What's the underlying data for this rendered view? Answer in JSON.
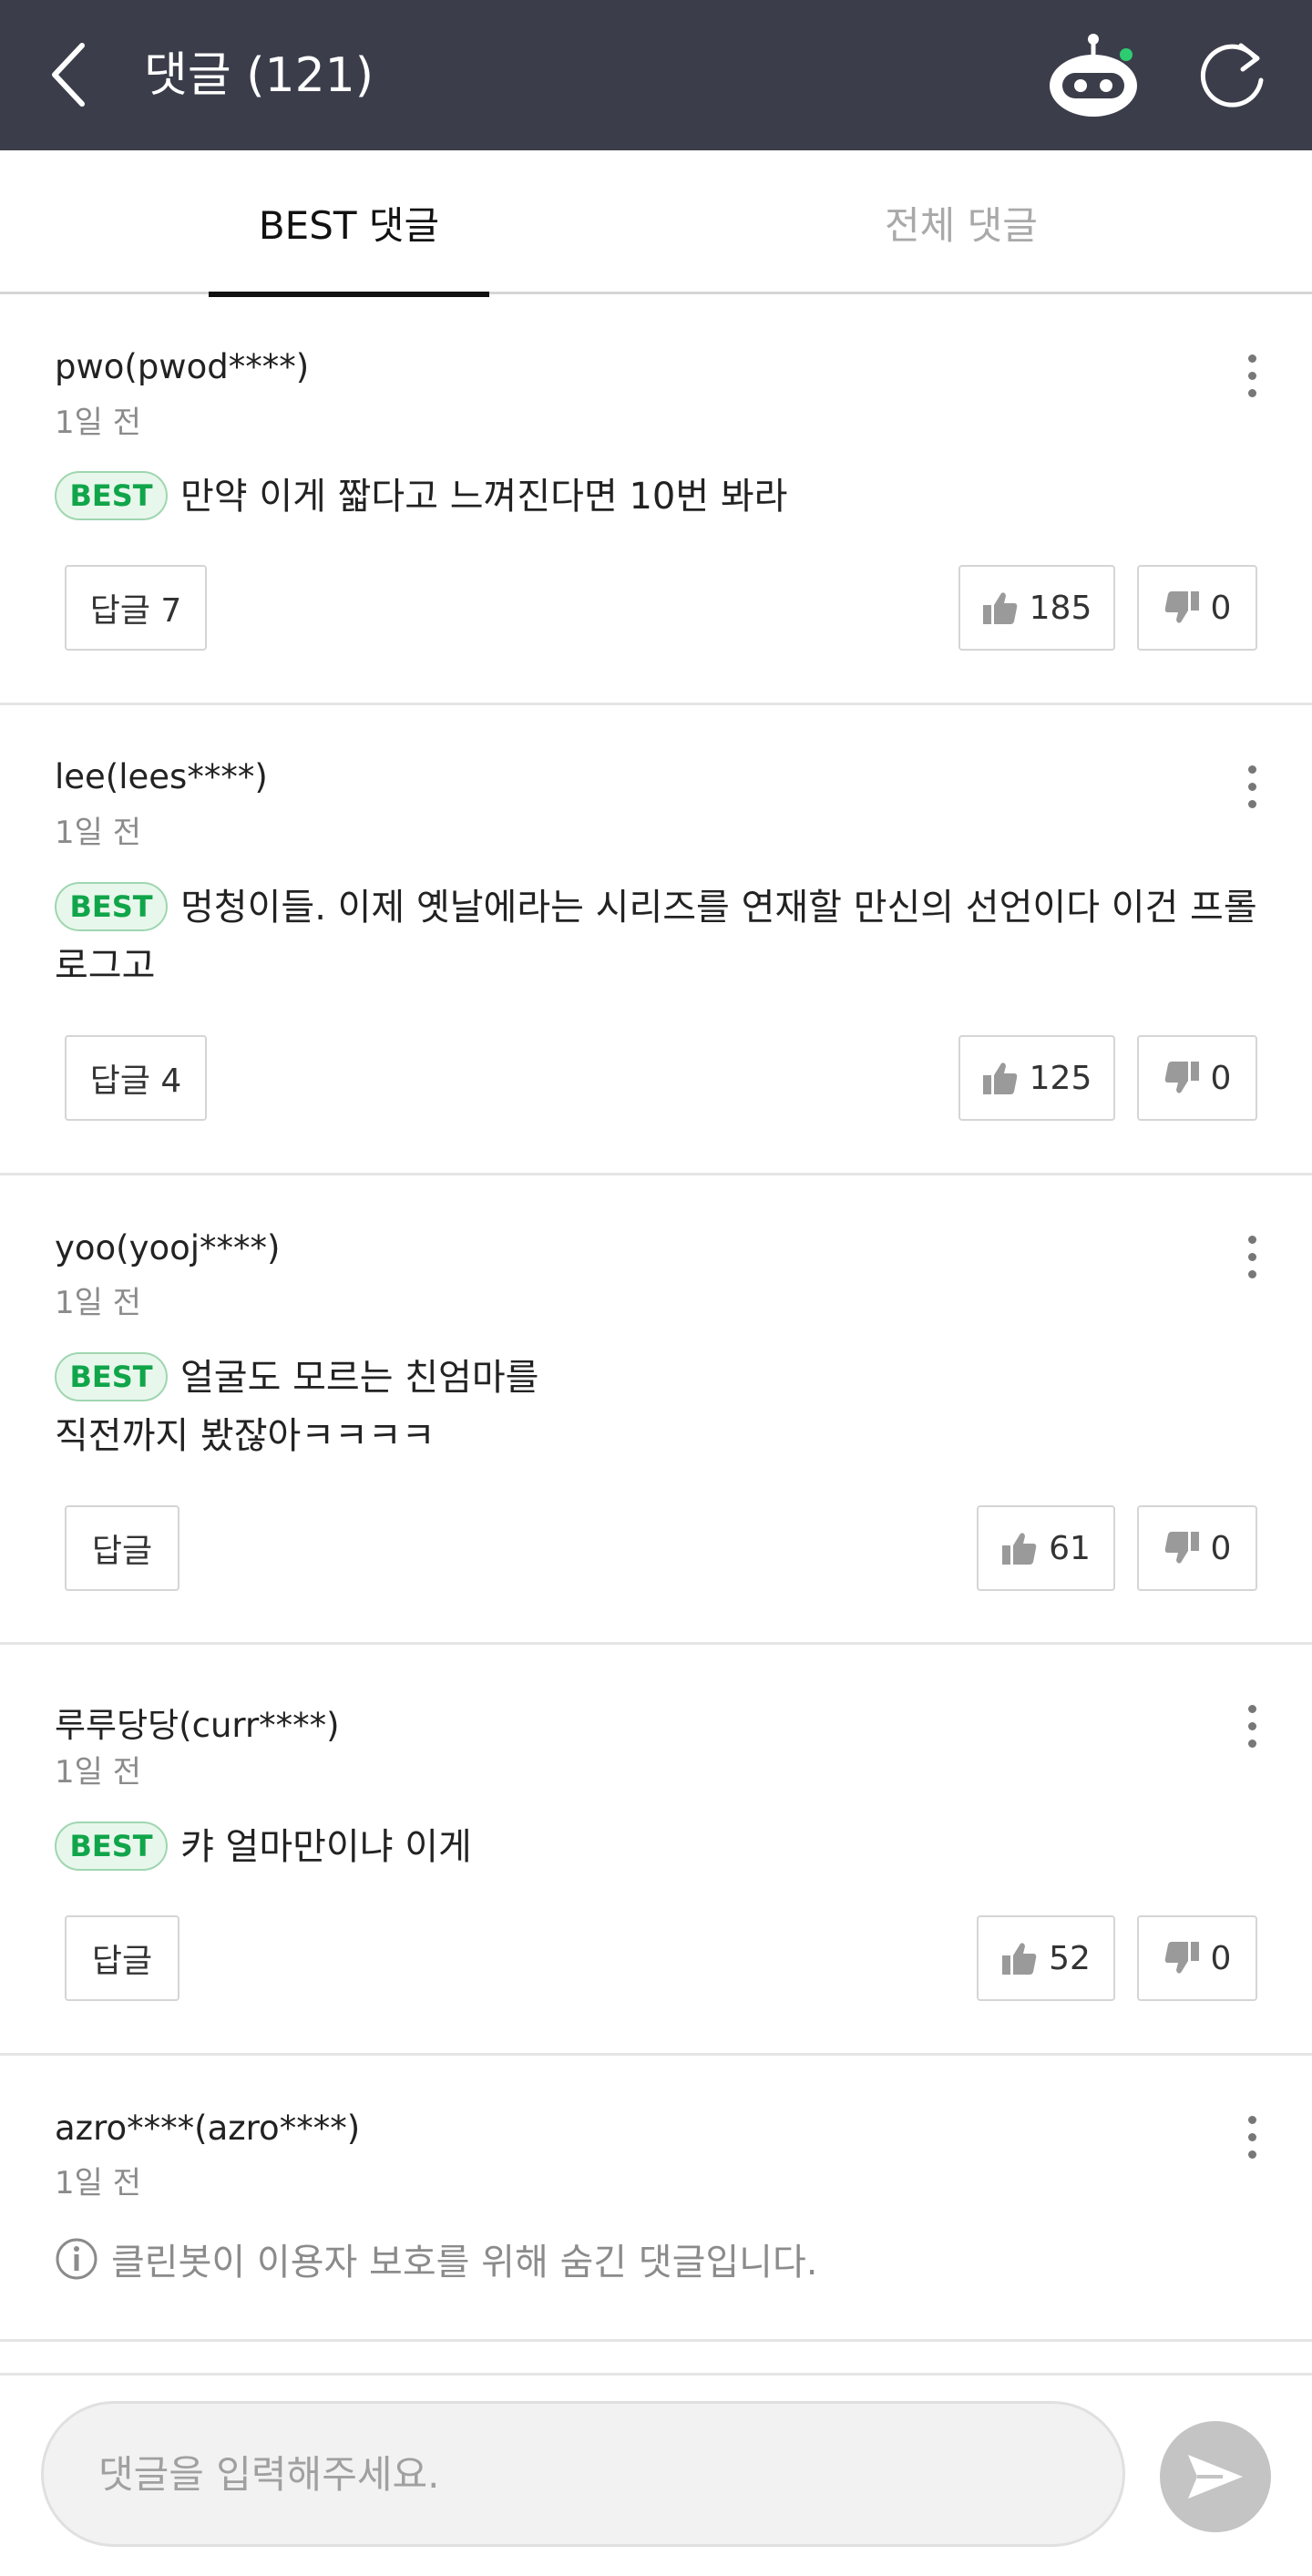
{
  "header": {
    "title": "댓글 (121)",
    "bg_color": "#3b3e4a",
    "back_icon": "chevron-left-icon",
    "bot_icon": "cleanbot-icon",
    "refresh_icon": "refresh-icon"
  },
  "tabs": [
    {
      "label": "BEST 댓글",
      "active": true
    },
    {
      "label": "전체 댓글",
      "active": false
    }
  ],
  "comments": [
    {
      "author": "pwo(pwod****)",
      "date": "1일 전",
      "badge": "BEST",
      "text": "만약 이게 짧다고 느껴진다면 10번 봐라",
      "reply_label": "답글 7",
      "likes": "185",
      "dislikes": "0"
    },
    {
      "author": "lee(lees****)",
      "date": "1일 전",
      "badge": "BEST",
      "text": "멍청이들. 이제 옛날에라는 시리즈를 연재할 만신의 선언이다 이건 프롤로그고",
      "reply_label": "답글 4",
      "likes": "125",
      "dislikes": "0"
    },
    {
      "author": "yoo(yooj****)",
      "date": "1일 전",
      "badge": "BEST",
      "text_line1": "얼굴도 모르는 친엄마를",
      "text_line2": "직전까지 봤잖아ㅋㅋㅋㅋ",
      "reply_label": "답글",
      "likes": "61",
      "dislikes": "0"
    },
    {
      "author": "루루당당(curr****)",
      "date": "1일 전",
      "badge": "BEST",
      "text": "캬 얼마만이냐 이게",
      "reply_label": "답글",
      "likes": "52",
      "dislikes": "0"
    },
    {
      "author": "azro****(azro****)",
      "date": "1일 전",
      "hidden_text": "클린봇이 이용자 보호를 위해 숨긴 댓글입니다."
    }
  ],
  "input": {
    "placeholder": "댓글을 입력해주세요.",
    "send_icon": "send-icon"
  },
  "colors": {
    "best_badge_text": "#11a54a",
    "best_badge_bg": "#e8f7ec",
    "bot_indicator": "#2ecc71"
  }
}
